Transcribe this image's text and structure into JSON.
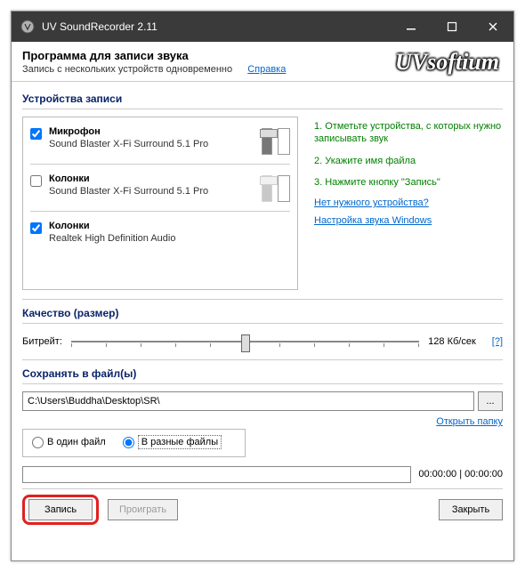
{
  "window": {
    "title": "UV SoundRecorder 2.11"
  },
  "header": {
    "title": "Программа для записи звука",
    "subtitle": "Запись с нескольких устройств одновременно",
    "help": "Справка",
    "brand": "UVsoftium"
  },
  "sections": {
    "devices": "Устройства записи",
    "quality": "Качество (размер)",
    "save": "Сохранять в файл(ы)"
  },
  "devices": [
    {
      "checked": true,
      "name": "Микрофон",
      "driver": "Sound Blaster X-Fi Surround 5.1 Pro"
    },
    {
      "checked": false,
      "name": "Колонки",
      "driver": "Sound Blaster X-Fi Surround 5.1 Pro"
    },
    {
      "checked": true,
      "name": "Колонки",
      "driver": "Realtek High Definition Audio"
    }
  ],
  "tips": {
    "t1": "1. Отметьте устройства, с которых нужно записывать звук",
    "t2": "2. Укажите имя файла",
    "t3": "3. Нажмите кнопку \"Запись\"",
    "link1": "Нет нужного устройства?",
    "link2": "Настройка звука Windows"
  },
  "quality": {
    "bitrate_label": "Битрейт:",
    "value_text": "128 Кб/сек",
    "help_mark": "[?]"
  },
  "save": {
    "path": "C:\\Users\\Buddha\\Desktop\\SR\\",
    "browse": "...",
    "open_folder": "Открыть папку",
    "one_file": "В один файл",
    "multi_file": "В разные файлы"
  },
  "time": {
    "elapsed": "00:00:00",
    "sep": " | ",
    "total": "00:00:00"
  },
  "buttons": {
    "record": "Запись",
    "play": "Проиграть",
    "close": "Закрыть"
  }
}
